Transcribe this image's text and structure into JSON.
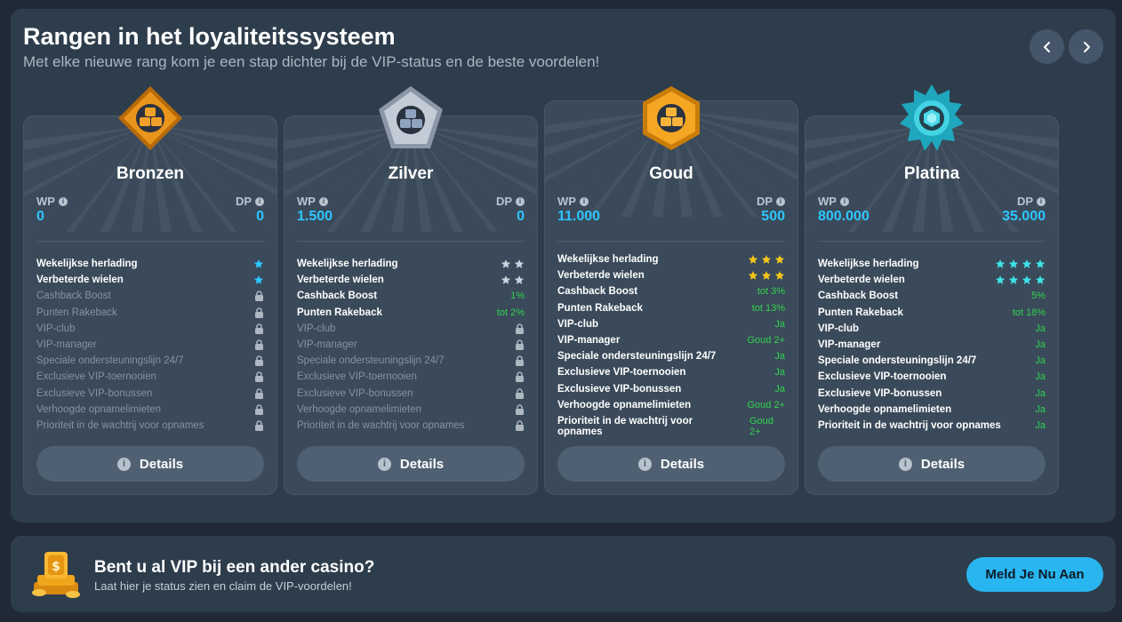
{
  "header": {
    "title": "Rangen in het loyaliteitssysteem",
    "subtitle": "Met elke nieuwe rang kom je een stap dichter bij de VIP-status en de beste voordelen!"
  },
  "colors": {
    "accent": "#2ec6ff",
    "positive": "#33d24e",
    "bronze": "#e08a12",
    "silver": "#a9b4c2",
    "gold": "#f5a623",
    "platinum": "#35c8dc"
  },
  "labels": {
    "wp": "WP",
    "dp": "DP",
    "details": "Details"
  },
  "ranks": [
    {
      "name": "Bronzen",
      "wp": "0",
      "dp": "0",
      "star_color": "#2ec6ff",
      "features": [
        {
          "name": "Wekelijkse herlading",
          "type": "stars",
          "stars": 1
        },
        {
          "name": "Verbeterde wielen",
          "type": "stars",
          "stars": 1
        },
        {
          "name": "Cashback Boost",
          "type": "lock"
        },
        {
          "name": "Punten Rakeback",
          "type": "lock"
        },
        {
          "name": "VIP-club",
          "type": "lock"
        },
        {
          "name": "VIP-manager",
          "type": "lock"
        },
        {
          "name": "Speciale ondersteuningslijn 24/7",
          "type": "lock"
        },
        {
          "name": "Exclusieve VIP-toernooien",
          "type": "lock"
        },
        {
          "name": "Exclusieve VIP-bonussen",
          "type": "lock"
        },
        {
          "name": "Verhoogde opnamelimieten",
          "type": "lock"
        },
        {
          "name": "Prioriteit in de wachtrij voor opnames",
          "type": "lock"
        }
      ]
    },
    {
      "name": "Zilver",
      "wp": "1.500",
      "dp": "0",
      "star_color": "#c9d1db",
      "features": [
        {
          "name": "Wekelijkse herlading",
          "type": "stars",
          "stars": 2
        },
        {
          "name": "Verbeterde wielen",
          "type": "stars",
          "stars": 2
        },
        {
          "name": "Cashback Boost",
          "type": "text",
          "value": "1%"
        },
        {
          "name": "Punten Rakeback",
          "type": "text",
          "value": "tot 2%"
        },
        {
          "name": "VIP-club",
          "type": "lock"
        },
        {
          "name": "VIP-manager",
          "type": "lock"
        },
        {
          "name": "Speciale ondersteuningslijn 24/7",
          "type": "lock"
        },
        {
          "name": "Exclusieve VIP-toernooien",
          "type": "lock"
        },
        {
          "name": "Exclusieve VIP-bonussen",
          "type": "lock"
        },
        {
          "name": "Verhoogde opnamelimieten",
          "type": "lock"
        },
        {
          "name": "Prioriteit in de wachtrij voor opnames",
          "type": "lock"
        }
      ]
    },
    {
      "name": "Goud",
      "wp": "11.000",
      "dp": "500",
      "star_color": "#f5c518",
      "features": [
        {
          "name": "Wekelijkse herlading",
          "type": "stars",
          "stars": 3
        },
        {
          "name": "Verbeterde wielen",
          "type": "stars",
          "stars": 3
        },
        {
          "name": "Cashback Boost",
          "type": "text",
          "value": "tot 3%"
        },
        {
          "name": "Punten Rakeback",
          "type": "text",
          "value": "tot 13%"
        },
        {
          "name": "VIP-club",
          "type": "text",
          "value": "Ja"
        },
        {
          "name": "VIP-manager",
          "type": "text",
          "value": "Goud 2+"
        },
        {
          "name": "Speciale ondersteuningslijn 24/7",
          "type": "text",
          "value": "Ja"
        },
        {
          "name": "Exclusieve VIP-toernooien",
          "type": "text",
          "value": "Ja"
        },
        {
          "name": "Exclusieve VIP-bonussen",
          "type": "text",
          "value": "Ja"
        },
        {
          "name": "Verhoogde opnamelimieten",
          "type": "text",
          "value": "Goud 2+"
        },
        {
          "name": "Prioriteit in de wachtrij voor opnames",
          "type": "text",
          "value": "Goud 2+"
        }
      ]
    },
    {
      "name": "Platina",
      "wp": "800.000",
      "dp": "35.000",
      "star_color": "#3fe0ea",
      "features": [
        {
          "name": "Wekelijkse herlading",
          "type": "stars",
          "stars": 4
        },
        {
          "name": "Verbeterde wielen",
          "type": "stars",
          "stars": 4
        },
        {
          "name": "Cashback Boost",
          "type": "text",
          "value": "5%"
        },
        {
          "name": "Punten Rakeback",
          "type": "text",
          "value": "tot 18%"
        },
        {
          "name": "VIP-club",
          "type": "text",
          "value": "Ja"
        },
        {
          "name": "VIP-manager",
          "type": "text",
          "value": "Ja"
        },
        {
          "name": "Speciale ondersteuningslijn 24/7",
          "type": "text",
          "value": "Ja"
        },
        {
          "name": "Exclusieve VIP-toernooien",
          "type": "text",
          "value": "Ja"
        },
        {
          "name": "Exclusieve VIP-bonussen",
          "type": "text",
          "value": "Ja"
        },
        {
          "name": "Verhoogde opnamelimieten",
          "type": "text",
          "value": "Ja"
        },
        {
          "name": "Prioriteit in de wachtrij voor opnames",
          "type": "text",
          "value": "Ja"
        }
      ]
    }
  ],
  "promo": {
    "title": "Bent u al VIP bij een ander casino?",
    "subtitle": "Laat hier je status zien en claim de VIP-voordelen!",
    "button_label": "Meld Je Nu Aan"
  }
}
